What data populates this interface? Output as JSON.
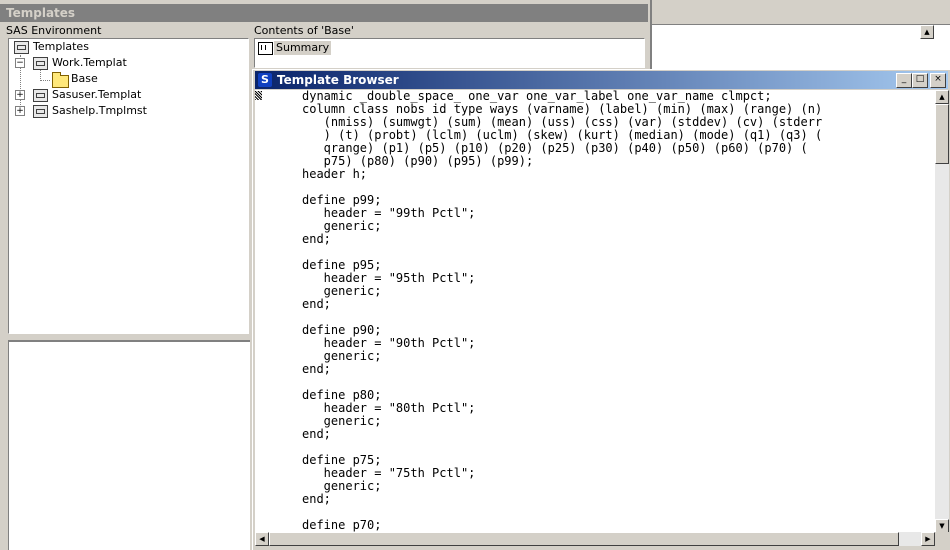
{
  "templates_window": {
    "title": "Templates",
    "left_header": "SAS Environment",
    "right_header": "Contents of 'Base'"
  },
  "tree": {
    "items": [
      {
        "label": "Templates",
        "icon": "library-icon",
        "expander": ""
      },
      {
        "label": "Work.Templat",
        "icon": "library-icon",
        "expander": "−"
      },
      {
        "label": "Base",
        "icon": "folder-icon",
        "expander": ""
      },
      {
        "label": "Sasuser.Templat",
        "icon": "library-icon",
        "expander": "+"
      },
      {
        "label": "Sashelp.Tmplmst",
        "icon": "library-icon",
        "expander": "+"
      }
    ]
  },
  "contents": {
    "items": [
      {
        "label": "Summary",
        "icon": "template-item-icon",
        "selected": true
      }
    ]
  },
  "browser": {
    "title": "Template Browser",
    "app_icon": "S",
    "buttons": {
      "minimize": "_",
      "maximize": "□",
      "close": "×"
    },
    "code": "dynamic _double_space_ one_var one_var_label one_var_name clmpct;\ncolumn class nobs id type ways (varname) (label) (min) (max) (range) (n)\n   (nmiss) (sumwgt) (sum) (mean) (uss) (css) (var) (stddev) (cv) (stderr\n   ) (t) (probt) (lclm) (uclm) (skew) (kurt) (median) (mode) (q1) (q3) (\n   qrange) (p1) (p5) (p10) (p20) (p25) (p30) (p40) (p50) (p60) (p70) (\n   p75) (p80) (p90) (p95) (p99);\nheader h;\n\ndefine p99;\n   header = \"99th Pctl\";\n   generic;\nend;\n\ndefine p95;\n   header = \"95th Pctl\";\n   generic;\nend;\n\ndefine p90;\n   header = \"90th Pctl\";\n   generic;\nend;\n\ndefine p80;\n   header = \"80th Pctl\";\n   generic;\nend;\n\ndefine p75;\n   header = \"75th Pctl\";\n   generic;\nend;\n\ndefine p70;"
  },
  "scroll_arrows": {
    "up": "▲",
    "down": "▼",
    "left": "◀",
    "right": "▶"
  }
}
